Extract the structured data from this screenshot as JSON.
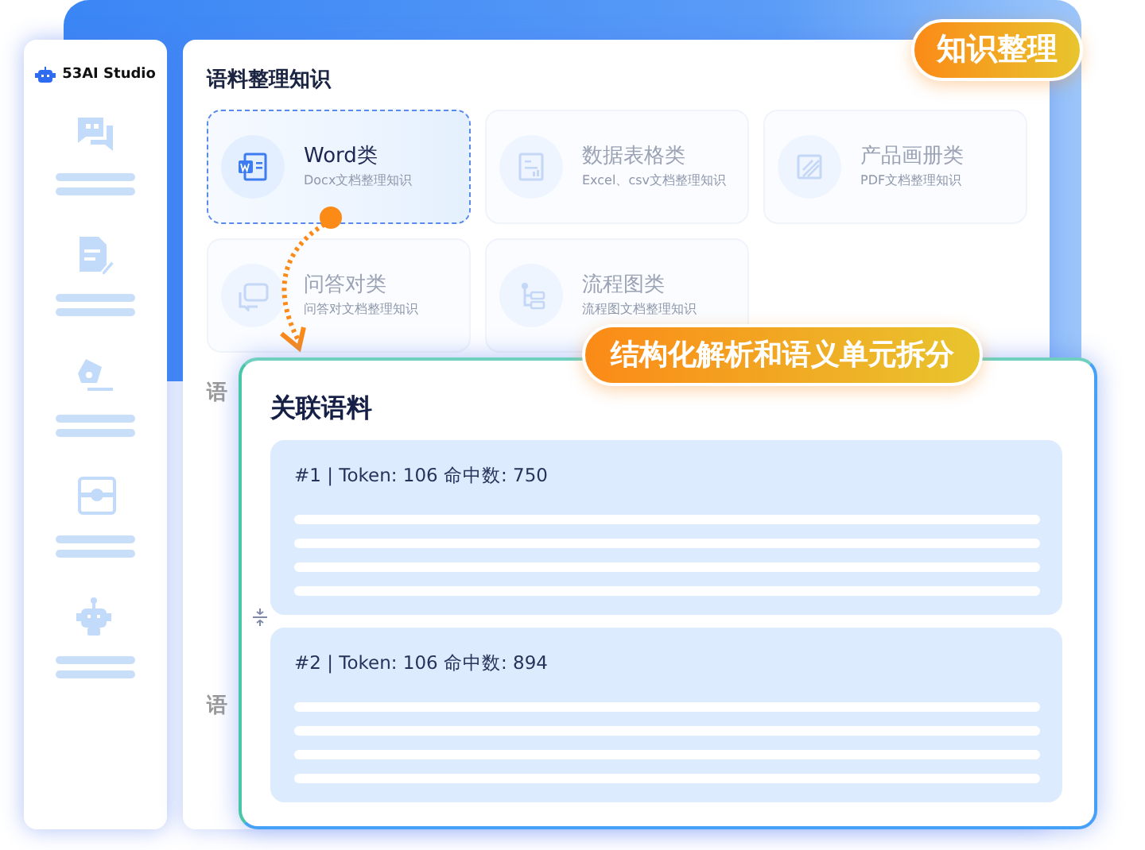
{
  "sidebar": {
    "logo": "53AI Studio",
    "items": [
      {
        "kind": "chat"
      },
      {
        "kind": "document"
      },
      {
        "kind": "pen"
      },
      {
        "kind": "panel"
      },
      {
        "kind": "robot"
      }
    ]
  },
  "main": {
    "title": "语料整理知识",
    "categories": [
      {
        "kind": "word",
        "title": "Word类",
        "subtitle": "Docx文档整理知识",
        "selected": true
      },
      {
        "kind": "table",
        "title": "数据表格类",
        "subtitle": "Excel、csv文档整理知识",
        "selected": false
      },
      {
        "kind": "album",
        "title": "产品画册类",
        "subtitle": "PDF文档整理知识",
        "selected": false
      },
      {
        "kind": "qa",
        "title": "问答对类",
        "subtitle": "问答对文档整理知识",
        "selected": false
      },
      {
        "kind": "flow",
        "title": "流程图类",
        "subtitle": "流程图文档整理知识",
        "selected": false
      }
    ],
    "covered_headings": [
      "语",
      "语"
    ]
  },
  "top_badge": "知识整理",
  "related": {
    "badge": "结构化解析和语义单元拆分",
    "title": "关联语料",
    "chunks": [
      {
        "header": "#1 | Token: 106 命中数: 750"
      },
      {
        "header": "#2 | Token: 106 命中数: 894"
      }
    ]
  }
}
